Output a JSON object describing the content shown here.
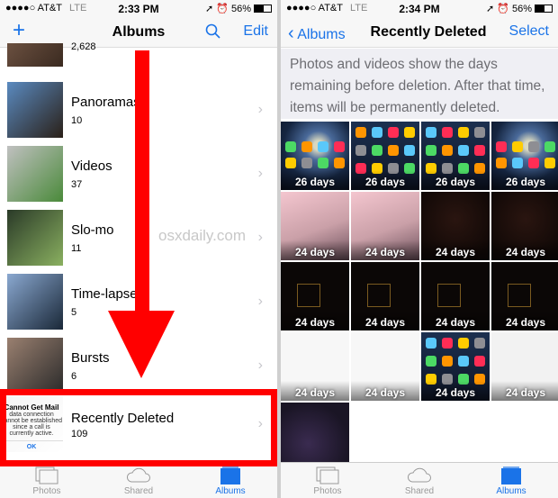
{
  "left": {
    "status": {
      "carrier": "●●●●○ AT&T",
      "network": "LTE",
      "time": "2:33 PM",
      "battery": "56%",
      "battery_level": 0.56
    },
    "nav": {
      "add_icon": "+",
      "title": "Albums",
      "search_icon": "search-icon",
      "edit": "Edit"
    },
    "albums": [
      {
        "name": "",
        "count": "2,628",
        "colors": [
          "#6b5040",
          "#3a2a20"
        ]
      },
      {
        "name": "Panoramas",
        "count": "10",
        "colors": [
          "#5a8ac0",
          "#2a2018"
        ]
      },
      {
        "name": "Videos",
        "count": "37",
        "colors": [
          "#c0c0c0",
          "#4a8a3a"
        ]
      },
      {
        "name": "Slo-mo",
        "count": "11",
        "colors": [
          "#2a3a28",
          "#8ab060"
        ]
      },
      {
        "name": "Time-lapse",
        "count": "5",
        "colors": [
          "#8aa8d0",
          "#1a2838"
        ]
      },
      {
        "name": "Bursts",
        "count": "6",
        "colors": [
          "#9a8070",
          "#2a2a2a"
        ]
      },
      {
        "name": "Recently Deleted",
        "count": "109",
        "colors": [
          "#f4f4f4",
          "#ffffff"
        ]
      }
    ],
    "deleted_thumb": {
      "title": "Cannot Get Mail",
      "body": "data connection cannot be established since a call is currently active.",
      "ok": "OK"
    },
    "watermark": "osxdaily.com",
    "tabs": [
      {
        "label": "Photos",
        "icon": "photos-icon",
        "active": false
      },
      {
        "label": "Shared",
        "icon": "cloud-icon",
        "active": false
      },
      {
        "label": "Albums",
        "icon": "albums-icon",
        "active": true
      }
    ]
  },
  "right": {
    "status": {
      "carrier": "●●●●○ AT&T",
      "network": "LTE",
      "time": "2:34 PM",
      "battery": "56%",
      "battery_level": 0.56
    },
    "nav": {
      "back": "Albums",
      "title": "Recently Deleted",
      "select": "Select"
    },
    "info": "Photos and videos show the days remaining before deletion. After that time, items will be permanently deleted.",
    "grid": [
      {
        "type": "galaxy",
        "days": "26 days"
      },
      {
        "type": "home",
        "days": "26 days"
      },
      {
        "type": "home",
        "days": "26 days"
      },
      {
        "type": "galaxy",
        "days": "26 days"
      },
      {
        "type": "keyboard",
        "days": "24 days"
      },
      {
        "type": "keyboard",
        "days": "24 days"
      },
      {
        "type": "dark",
        "days": "24 days"
      },
      {
        "type": "dark",
        "days": "24 days"
      },
      {
        "type": "gridpic",
        "days": "24 days"
      },
      {
        "type": "gridpic",
        "days": "24 days"
      },
      {
        "type": "gridpic",
        "days": "24 days"
      },
      {
        "type": "gridpic",
        "days": "24 days"
      },
      {
        "type": "web",
        "days": "24 days"
      },
      {
        "type": "web",
        "days": "24 days"
      },
      {
        "type": "home",
        "days": "24 days"
      },
      {
        "type": "settings",
        "days": "24 days"
      },
      {
        "type": "music",
        "days": ""
      },
      {
        "type": "note",
        "days": ""
      },
      {
        "type": "note",
        "days": ""
      },
      {
        "type": "note",
        "days": ""
      }
    ],
    "tabs": [
      {
        "label": "Photos",
        "icon": "photos-icon",
        "active": false
      },
      {
        "label": "Shared",
        "icon": "cloud-icon",
        "active": false
      },
      {
        "label": "Albums",
        "icon": "albums-icon",
        "active": true
      }
    ]
  },
  "colors": {
    "accent": "#1a73e8",
    "annotation": "#ff0000"
  }
}
